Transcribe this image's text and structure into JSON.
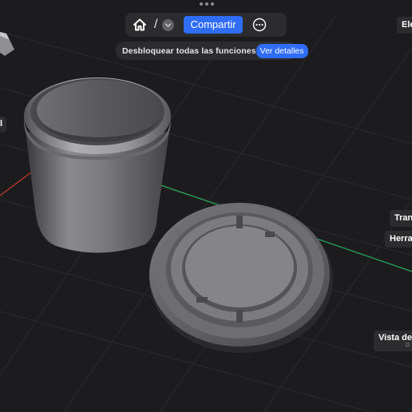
{
  "toolbar": {
    "home_icon": "home-icon",
    "path_separator": "/",
    "dropdown_icon": "chevron-down-icon",
    "share_label": "Compartir",
    "more_icon": "ellipsis-circle-icon"
  },
  "banner": {
    "text": "Desbloquear todas las funciones",
    "button_label": "Ver detalles"
  },
  "side_panels": {
    "elements": "Ele",
    "transform": "Tran",
    "tools": "Herra",
    "view": "Vista de",
    "view_sub": "D",
    "left_edge": "l"
  },
  "colors": {
    "background": "#1c1c1e",
    "panel": "#2c2c2e",
    "accent": "#2f6df6",
    "grid": "#2a2a2c",
    "axis_x": "#c0392b",
    "axis_y": "#27ae60"
  },
  "viewport": {
    "objects": [
      "cylindrical-container",
      "lid"
    ]
  }
}
